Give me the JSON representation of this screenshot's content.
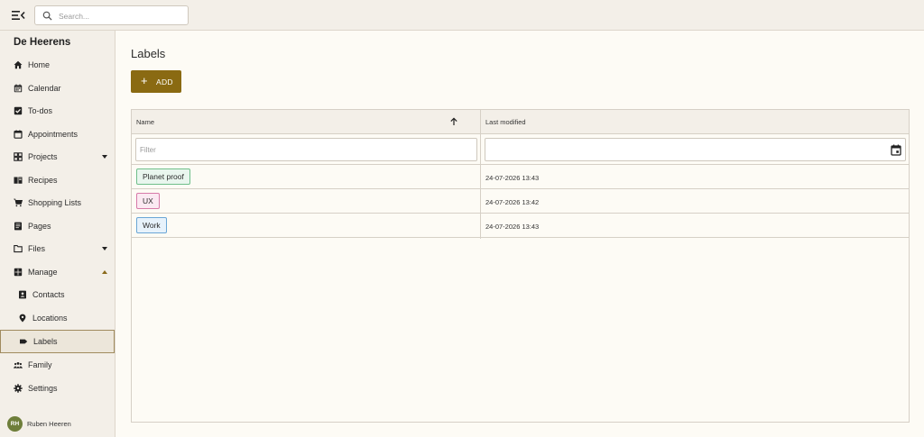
{
  "search": {
    "placeholder": "Search..."
  },
  "sidebar": {
    "brand": "De Heerens",
    "items": [
      {
        "label": "Home",
        "icon": "home-icon"
      },
      {
        "label": "Calendar",
        "icon": "calendar-icon"
      },
      {
        "label": "To-dos",
        "icon": "checkbox-icon"
      },
      {
        "label": "Appointments",
        "icon": "calendar-blank-icon"
      },
      {
        "label": "Projects",
        "icon": "grid-icon",
        "expand": "collapsed"
      },
      {
        "label": "Recipes",
        "icon": "book-icon"
      },
      {
        "label": "Shopping Lists",
        "icon": "cart-icon"
      },
      {
        "label": "Pages",
        "icon": "document-icon"
      },
      {
        "label": "Files",
        "icon": "folder-icon",
        "expand": "collapsed"
      },
      {
        "label": "Manage",
        "icon": "manage-grid-icon",
        "expand": "expanded"
      },
      {
        "label": "Contacts",
        "icon": "contact-card-icon"
      },
      {
        "label": "Locations",
        "icon": "map-pin-icon"
      },
      {
        "label": "Labels",
        "icon": "label-tag-icon",
        "active": true
      },
      {
        "label": "Family",
        "icon": "people-icon"
      },
      {
        "label": "Settings",
        "icon": "gear-icon"
      }
    ],
    "user": {
      "initials": "RH",
      "name": "Ruben Heeren",
      "avatar_color": "#6e7e3a"
    }
  },
  "main": {
    "title": "Labels",
    "add_button": {
      "label": "ADD",
      "color": "#8a6a12"
    },
    "table": {
      "columns": [
        "Name",
        "Last modified"
      ],
      "sort": "ascending",
      "filter_placeholder": "Filter",
      "rows": [
        {
          "name": "Planet proof",
          "modified": "24-07-2026 13:43",
          "chip_bg": "#e9f6ee",
          "chip_border": "#6fbf8a"
        },
        {
          "name": "UX",
          "modified": "24-07-2026 13:42",
          "chip_bg": "#fbe9f2",
          "chip_border": "#d77aa9"
        },
        {
          "name": "Work",
          "modified": "24-07-2026 13:43",
          "chip_bg": "#e7f2fb",
          "chip_border": "#6aa6d6"
        }
      ]
    }
  }
}
